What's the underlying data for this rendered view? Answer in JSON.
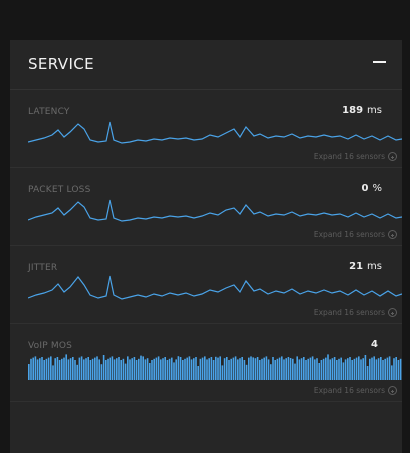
{
  "panel": {
    "title": "SERVICE"
  },
  "metrics": [
    {
      "label": "LATENCY",
      "value": "189",
      "unit": "ms",
      "expand": "Expand 16 sensors",
      "chart": "line"
    },
    {
      "label": "PACKET LOSS",
      "value": "0",
      "unit": "%",
      "expand": "Expand 16 sensors",
      "chart": "line"
    },
    {
      "label": "JITTER",
      "value": "21",
      "unit": "ms",
      "expand": "Expand 16 sensors",
      "chart": "line"
    },
    {
      "label": "VoIP MOS",
      "value": "4",
      "unit": "",
      "expand": "Expand 16 sensors",
      "chart": "bar"
    }
  ],
  "colors": {
    "accent": "#4aa3e8",
    "panel": "#262626",
    "background": "#161616"
  }
}
